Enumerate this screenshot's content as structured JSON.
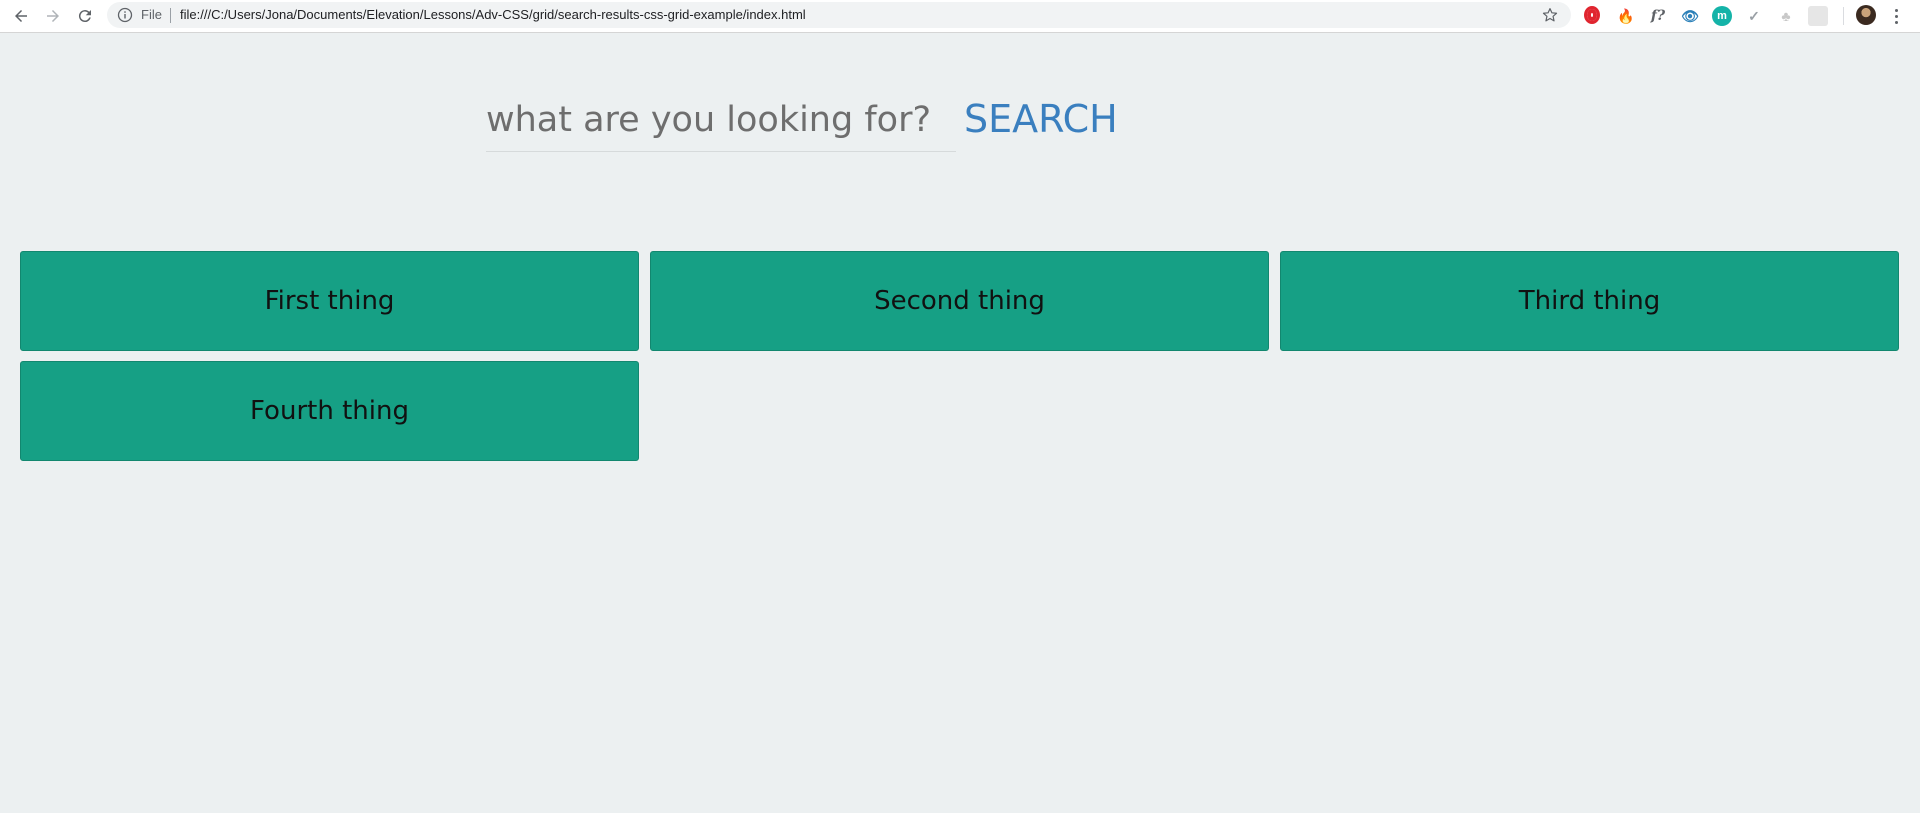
{
  "browser": {
    "omnibox": {
      "scheme_label": "File",
      "url": "file:///C:/Users/Jona/Documents/Elevation/Lessons/Adv-CSS/grid/search-results-css-grid-example/index.html"
    },
    "nav_icons": [
      "back-arrow-icon",
      "forward-arrow-icon",
      "reload-icon"
    ],
    "extensions": [
      {
        "name": "opera-extension-icon",
        "color": "#e0252f",
        "glyph": ""
      },
      {
        "name": "fire-extension-icon",
        "color": "#e8761b",
        "glyph": "🔥"
      },
      {
        "name": "function-extension-icon",
        "color": "#5f6368",
        "glyph": "f?"
      },
      {
        "name": "eye-extension-icon",
        "color": "#2a7fb8",
        "glyph": "👁"
      },
      {
        "name": "m-extension-icon",
        "color": "#14b3a8",
        "glyph": "m"
      },
      {
        "name": "check-extension-icon",
        "color": "#9aa0a6",
        "glyph": "✓"
      },
      {
        "name": "tree-extension-icon",
        "color": "#c8c8c8",
        "glyph": "♣"
      },
      {
        "name": "square-extension-icon",
        "color": "#e6e6e6",
        "glyph": ""
      }
    ]
  },
  "search": {
    "placeholder": "what are you looking for?",
    "button_label": "SEARCH"
  },
  "results": [
    {
      "label": "First thing"
    },
    {
      "label": "Second thing"
    },
    {
      "label": "Third thing"
    },
    {
      "label": "Fourth thing"
    }
  ],
  "colors": {
    "page_background": "#ecf0f1",
    "card_background": "#16a085",
    "search_button": "#3a7fbf",
    "placeholder_text": "#6e6e6e"
  }
}
